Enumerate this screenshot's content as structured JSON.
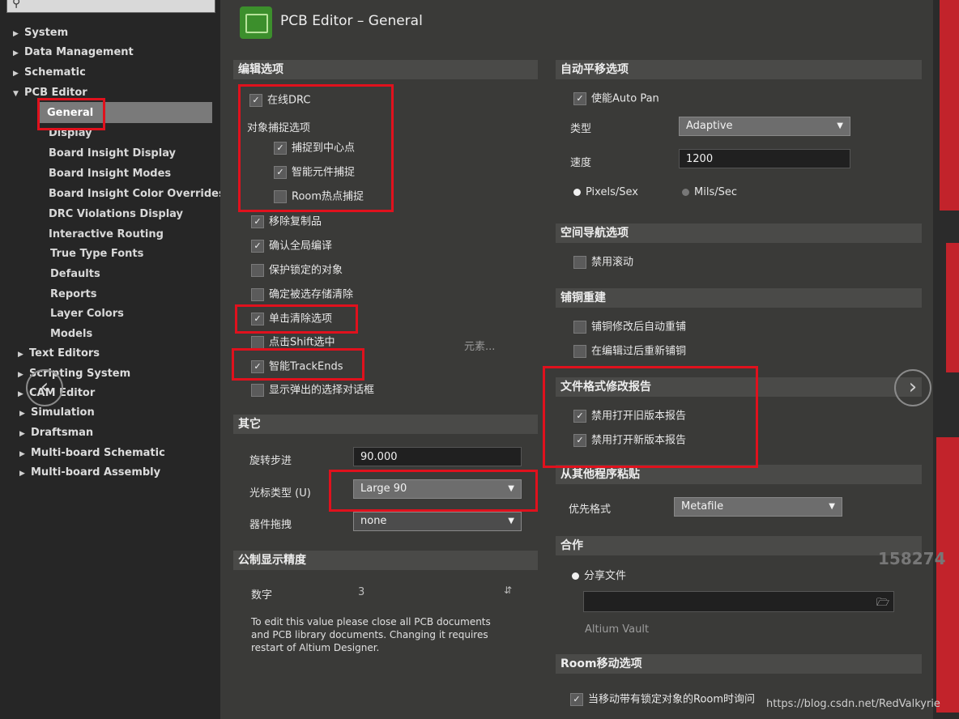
{
  "window": {
    "title": "PCB Editor – General"
  },
  "search": {
    "icon": "magnifier-icon"
  },
  "tree": {
    "top": [
      {
        "label": "System",
        "arrow": "▶"
      },
      {
        "label": "Data Management",
        "arrow": "▶"
      },
      {
        "label": "Schematic",
        "arrow": "▶"
      },
      {
        "label": "PCB Editor",
        "arrow": "▼"
      }
    ],
    "pcb_children": [
      "General",
      "Display",
      "Board Insight Display",
      "Board Insight Modes",
      "Board Insight Color Overrides",
      "DRC Violations Display",
      "Interactive Routing",
      "True Type Fonts",
      "Defaults",
      "Reports",
      "Layer Colors",
      "Models"
    ],
    "bottom": [
      {
        "label": "Text Editors",
        "arrow": "▶"
      },
      {
        "label": "Scripting System",
        "arrow": "▶"
      },
      {
        "label": "CAM Editor",
        "arrow": "▶"
      },
      {
        "label": "Simulation",
        "arrow": "▶"
      },
      {
        "label": "Draftsman",
        "arrow": "▶"
      },
      {
        "label": "Multi-board Schematic",
        "arrow": "▶"
      },
      {
        "label": "Multi-board Assembly",
        "arrow": "▶"
      }
    ]
  },
  "edit_options": {
    "header": "编辑选项",
    "online_drc": {
      "label": "在线DRC",
      "checked": true
    },
    "snap_group_label": "对象捕捉选项",
    "snap_center": {
      "label": "捕捉到中心点",
      "checked": true
    },
    "smart_snap": {
      "label": "智能元件捕捉",
      "checked": true
    },
    "room_hotspot": {
      "label": "Room热点捕捉",
      "checked": false
    },
    "remove_dup": {
      "label": "移除复制品",
      "checked": true
    },
    "confirm_global": {
      "label": "确认全局编译",
      "checked": true
    },
    "protect_locked": {
      "label": "保护锁定的对象",
      "checked": false
    },
    "confirm_clear": {
      "label": "确定被选存储清除",
      "checked": false
    },
    "click_clear": {
      "label": "单击清除选项",
      "checked": true
    },
    "shift_select": {
      "label": "点击Shift选中",
      "checked": false
    },
    "smart_trackends": {
      "label": "智能TrackEnds",
      "checked": true
    },
    "show_popup": {
      "label": "显示弹出的选择对话框",
      "checked": false
    },
    "elements_link": "元素..."
  },
  "other": {
    "header": "其它",
    "rotation_label": "旋转步进",
    "rotation_value": "90.000",
    "cursor_label": "光标类型 (U)",
    "cursor_value": "Large 90",
    "comp_drag_label": "器件拖拽",
    "comp_drag_value": "none"
  },
  "metric": {
    "header": "公制显示精度",
    "digits_label": "数字",
    "digits_value": "3",
    "note": "To edit this value please close all PCB documents and PCB library documents. Changing it requires restart of Altium Designer."
  },
  "autopan": {
    "header": "自动平移选项",
    "enable": {
      "label": "使能Auto Pan",
      "checked": true
    },
    "type_label": "类型",
    "type_value": "Adaptive",
    "speed_label": "速度",
    "speed_value": "1200",
    "unit_pixels": "Pixels/Sex",
    "unit_mils": "Mils/Sec"
  },
  "space_nav": {
    "header": "空间导航选项",
    "disable_roll": {
      "label": "禁用滚动",
      "checked": false
    }
  },
  "polygon": {
    "header": "铺铜重建",
    "auto_repour": {
      "label": "铺铜修改后自动重铺",
      "checked": false
    },
    "repour_after_edit": {
      "label": "在编辑过后重新铺铜",
      "checked": false
    }
  },
  "file_format": {
    "header": "文件格式修改报告",
    "disable_old": {
      "label": "禁用打开旧版本报告",
      "checked": true
    },
    "disable_new": {
      "label": "禁用打开新版本报告",
      "checked": true
    }
  },
  "paste": {
    "header": "从其他程序粘贴",
    "pref_label": "优先格式",
    "pref_value": "Metafile"
  },
  "collab": {
    "header": "合作",
    "share_label": "分享文件",
    "vault_label": "Altium Vault"
  },
  "room_move": {
    "header": "Room移动选项",
    "ask_locked": {
      "label": "当移动带有锁定对象的Room时询问",
      "checked": true
    }
  },
  "overlay": {
    "phone_partial": "158274",
    "watermark": "https://blog.csdn.net/RedValkyrie"
  },
  "colors": {
    "highlight": "#e0111d",
    "panel": "#3a3a38",
    "tree": "#262626"
  }
}
